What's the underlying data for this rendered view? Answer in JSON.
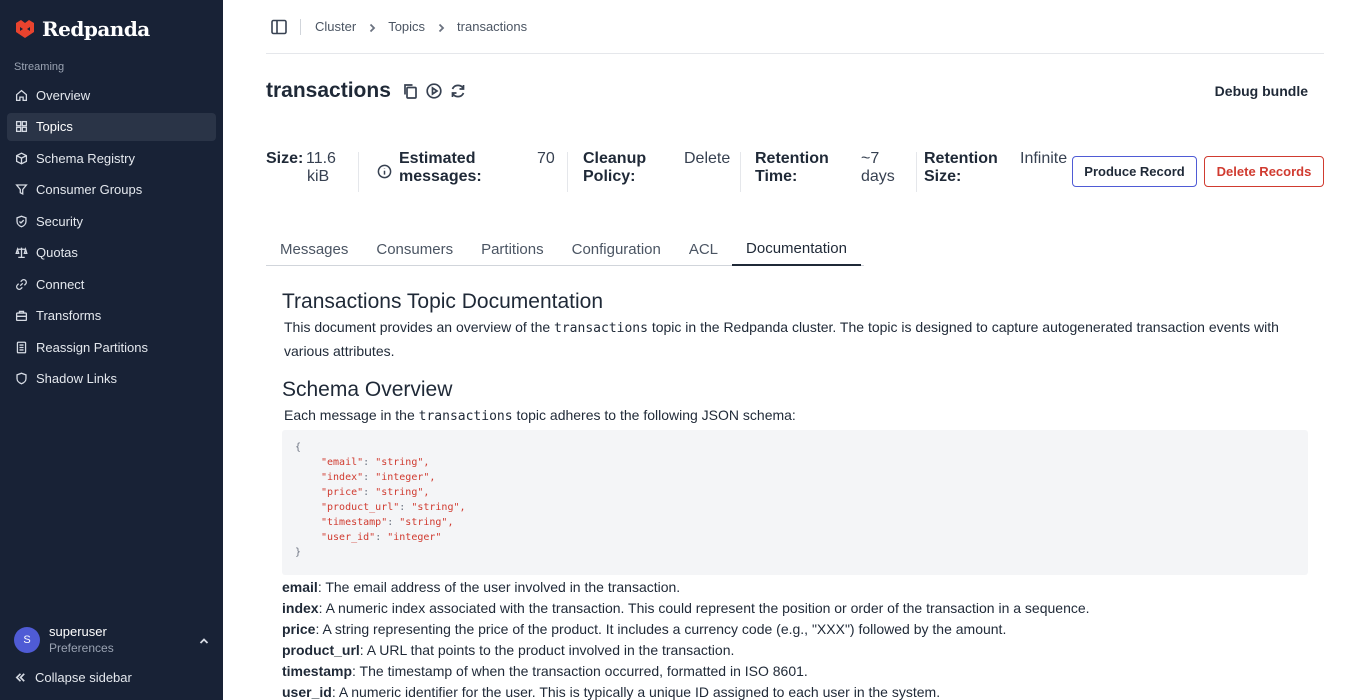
{
  "sidebar": {
    "logo_text": "Redpanda",
    "section": "Streaming",
    "items": [
      {
        "label": "Overview",
        "icon": "home-icon"
      },
      {
        "label": "Topics",
        "icon": "grid-icon"
      },
      {
        "label": "Schema Registry",
        "icon": "cube-icon"
      },
      {
        "label": "Consumer Groups",
        "icon": "filter-icon"
      },
      {
        "label": "Security",
        "icon": "shield-check-icon"
      },
      {
        "label": "Quotas",
        "icon": "scale-icon"
      },
      {
        "label": "Connect",
        "icon": "link-icon"
      },
      {
        "label": "Transforms",
        "icon": "briefcase-icon"
      },
      {
        "label": "Reassign Partitions",
        "icon": "list-icon"
      },
      {
        "label": "Shadow Links",
        "icon": "shield-icon"
      }
    ],
    "active_item": "Topics",
    "user": {
      "initial": "S",
      "name": "superuser",
      "sub": "Preferences"
    },
    "collapse_label": "Collapse sidebar"
  },
  "breadcrumb": [
    "Cluster",
    "Topics",
    "transactions"
  ],
  "title": "transactions",
  "debug_bundle_label": "Debug bundle",
  "stats": {
    "size_label": "Size:",
    "size_value_1": "11.6",
    "size_value_2": "kiB",
    "messages_label_1": "Estimated",
    "messages_label_2": "messages:",
    "messages_value": "70",
    "cleanup_label_1": "Cleanup",
    "cleanup_label_2": "Policy:",
    "cleanup_value": "Delete",
    "retention_time_label_1": "Retention",
    "retention_time_label_2": "Time:",
    "retention_time_value_1": "~7",
    "retention_time_value_2": "days",
    "retention_size_label_1": "Retention",
    "retention_size_label_2": "Size:",
    "retention_size_value": "Infinite"
  },
  "buttons": {
    "produce": "Produce Record",
    "delete": "Delete Records"
  },
  "tabs": [
    "Messages",
    "Consumers",
    "Partitions",
    "Configuration",
    "ACL",
    "Documentation"
  ],
  "active_tab": "Documentation",
  "doc": {
    "heading": "Transactions Topic Documentation",
    "intro_before": "This document provides an overview of the ",
    "intro_code": "transactions",
    "intro_after": " topic in the Redpanda cluster. The topic is designed to capture autogenerated transaction events with various attributes.",
    "schema_heading": "Schema Overview",
    "schema_before": "Each message in the ",
    "schema_code": "transactions",
    "schema_after": " topic adheres to the following JSON schema:",
    "schema_lines": [
      {
        "key": "\"email\"",
        "value": "\"string\","
      },
      {
        "key": "\"index\"",
        "value": "\"integer\","
      },
      {
        "key": "\"price\"",
        "value": "\"string\","
      },
      {
        "key": "\"product_url\"",
        "value": "\"string\","
      },
      {
        "key": "\"timestamp\"",
        "value": "\"string\","
      },
      {
        "key": "\"user_id\"",
        "value": "\"integer\""
      }
    ],
    "brace_open": "{",
    "brace_close": "}",
    "fields": [
      {
        "name": "email",
        "desc": ": The email address of the user involved in the transaction."
      },
      {
        "name": "index",
        "desc": ": A numeric index associated with the transaction. This could represent the position or order of the transaction in a sequence."
      },
      {
        "name": "price",
        "desc": ": A string representing the price of the product. It includes a currency code (e.g., \"XXX\") followed by the amount."
      },
      {
        "name": "product_url",
        "desc": ": A URL that points to the product involved in the transaction."
      },
      {
        "name": "timestamp",
        "desc": ": The timestamp of when the transaction occurred, formatted in ISO 8601."
      },
      {
        "name": "user_id",
        "desc": ": A numeric identifier for the user. This is typically a unique ID assigned to each user in the system."
      }
    ]
  },
  "colors": {
    "sidebar_bg": "#182236",
    "brand": "#e8432e",
    "primary_outline": "#4f5bd5",
    "danger": "#d03b30"
  }
}
